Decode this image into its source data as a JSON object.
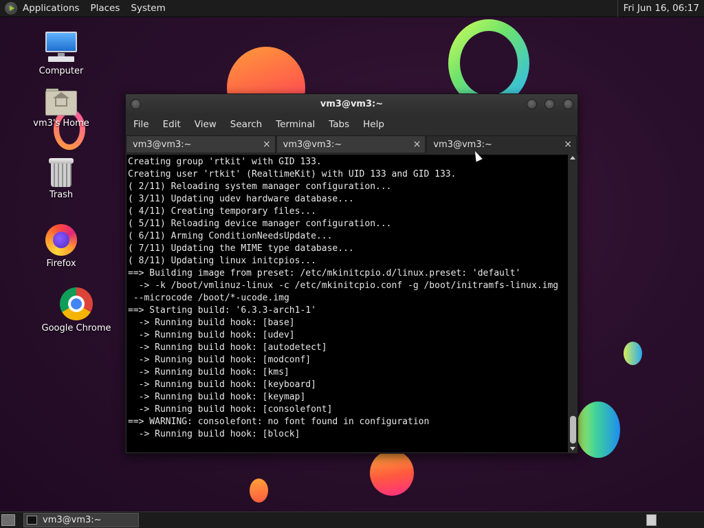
{
  "top_panel": {
    "menus": [
      "Applications",
      "Places",
      "System"
    ],
    "clock": "Fri Jun 16, 06:17"
  },
  "desktop_icons": [
    {
      "label": "Computer",
      "icon": "computer-icon"
    },
    {
      "label": "vm3's Home",
      "icon": "home-folder-icon"
    },
    {
      "label": "Trash",
      "icon": "trash-icon"
    },
    {
      "label": "Firefox",
      "icon": "firefox-icon"
    },
    {
      "label": "Google Chrome",
      "icon": "chrome-icon"
    }
  ],
  "terminal": {
    "title": "vm3@vm3:~",
    "menu": [
      "File",
      "Edit",
      "View",
      "Search",
      "Terminal",
      "Tabs",
      "Help"
    ],
    "tabs": [
      {
        "label": "vm3@vm3:~",
        "close": "×"
      },
      {
        "label": "vm3@vm3:~",
        "close": "×"
      },
      {
        "label": "vm3@vm3:~",
        "close": "×"
      }
    ],
    "active_tab": 2,
    "lines": [
      "Creating group 'rtkit' with GID 133.",
      "Creating user 'rtkit' (RealtimeKit) with UID 133 and GID 133.",
      "( 2/11) Reloading system manager configuration...",
      "( 3/11) Updating udev hardware database...",
      "( 4/11) Creating temporary files...",
      "( 5/11) Reloading device manager configuration...",
      "( 6/11) Arming ConditionNeedsUpdate...",
      "( 7/11) Updating the MIME type database...",
      "( 8/11) Updating linux initcpios...",
      "==> Building image from preset: /etc/mkinitcpio.d/linux.preset: 'default'",
      "  -> -k /boot/vmlinuz-linux -c /etc/mkinitcpio.conf -g /boot/initramfs-linux.img",
      " --microcode /boot/*-ucode.img",
      "==> Starting build: '6.3.3-arch1-1'",
      "  -> Running build hook: [base]",
      "  -> Running build hook: [udev]",
      "  -> Running build hook: [autodetect]",
      "  -> Running build hook: [modconf]",
      "  -> Running build hook: [kms]",
      "  -> Running build hook: [keyboard]",
      "  -> Running build hook: [keymap]",
      "  -> Running build hook: [consolefont]",
      "==> WARNING: consolefont: no font found in configuration",
      "  -> Running build hook: [block]"
    ]
  },
  "bottom_panel": {
    "task_label": "vm3@vm3:~"
  },
  "colors": {
    "desktop_bg": "#2a0f2c",
    "panel_bg": "#1c1c1c",
    "terminal_bg": "#000000",
    "terminal_fg": "#e8e8e8"
  }
}
